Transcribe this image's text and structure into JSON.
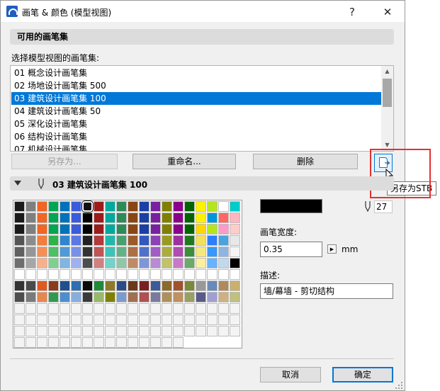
{
  "window": {
    "title": "画笔 & 颜色 (模型视图)",
    "help_label": "?",
    "close_label": "✕"
  },
  "available_sets": {
    "header": "可用的画笔集",
    "list_label": "选择模型视图的画笔集:",
    "items": [
      "01 概念设计画笔集",
      "02 场地设计画笔集 500",
      "03 建筑设计画笔集 100",
      "04 建筑设计画笔集 50",
      "05 深化设计画笔集",
      "06 结构设计画笔集",
      "07 机械设计画笔集"
    ],
    "selected_index": 2
  },
  "buttons": {
    "save_as": "另存为...",
    "rename": "重命名...",
    "delete": "删除",
    "save_stb_tooltip": "另存为STB",
    "cancel": "取消",
    "ok": "确定"
  },
  "pen_set": {
    "header": "03 建筑设计画笔集 100",
    "pen_number": "27",
    "selected_color": "#000000",
    "width_label": "画笔宽度:",
    "width_value": "0.35",
    "width_unit": "mm",
    "description_label": "描述:",
    "description_value": "墙/幕墙 - 剪切结构"
  },
  "palette": {
    "columns": 20,
    "rows": [
      [
        "#1a1a1a",
        "#7f7f7f",
        "#f26522",
        "#00a651",
        "#0072bc",
        "#3b5bdb",
        "#111111",
        "#9e1b1b",
        "#00a99d",
        "#2e8b57",
        "#8b4513",
        "#1c3fa6",
        "#7b1fa2",
        "#808000",
        "#8b008b",
        "#006400",
        "#fff200",
        "#b5e61d",
        "#ffffff",
        "#00cccc"
      ],
      [
        "#1a1a1a",
        "#7f7f7f",
        "#f26522",
        "#00a651",
        "#0072bc",
        "#3b5bdb",
        "#000000",
        "#9e1b1b",
        "#00a99d",
        "#2e8b57",
        "#8b4513",
        "#1c3fa6",
        "#7b1fa2",
        "#808000",
        "#8b008b",
        "#006400",
        "#fff200",
        "#0095d9",
        "#ff6666",
        "#ffb6c1"
      ],
      [
        "#1a1a1a",
        "#7f7f7f",
        "#f26522",
        "#00a651",
        "#0072bc",
        "#3b5bdb",
        "#000000",
        "#9e1b1b",
        "#00a99d",
        "#2e8b57",
        "#8b4513",
        "#1c3fa6",
        "#7b1fa2",
        "#808000",
        "#8b008b",
        "#006400",
        "#ffd700",
        "#b5e61d",
        "#ff99cc",
        "#ffcccc"
      ],
      [
        "#555555",
        "#8c8c8c",
        "#f47c3c",
        "#2db34a",
        "#2f86d0",
        "#5b78e6",
        "#222222",
        "#b23a3a",
        "#1fb8ad",
        "#48a06f",
        "#9c5a2a",
        "#3357bf",
        "#8f3fb8",
        "#9a9a1f",
        "#a030a0",
        "#1f7a1f",
        "#f5e05a",
        "#2a7fff",
        "#4aa3df",
        "#e8e8e8"
      ],
      [
        "#606060",
        "#969696",
        "#f68f55",
        "#4cc064",
        "#4f9ad8",
        "#7790ea",
        "#333333",
        "#c05555",
        "#3cc4b8",
        "#62b287",
        "#ac6f42",
        "#4f70cc",
        "#a25cc6",
        "#acac3c",
        "#b24cb2",
        "#3a8f3a",
        "#f7e87a",
        "#3399ff",
        "#8db4e2",
        "#f5f5f5"
      ],
      [
        "#6e6e6e",
        "#a6a6a6",
        "#f9b08a",
        "#7fd08e",
        "#7fb6e3",
        "#9fb1f0",
        "#4d4d4d",
        "#d08080",
        "#70d4cb",
        "#8fc8a6",
        "#c08a66",
        "#7f96d9",
        "#b98ad5",
        "#c2c26b",
        "#c77ac7",
        "#6aab6a",
        "#faf0a0",
        "#66b3ff",
        "#c0d8f0",
        "#000000"
      ],
      [
        "#ffffff",
        "#ffffff",
        "#ffffff",
        "#ffffff",
        "#ffffff",
        "#ffffff",
        "#ffffff",
        "#ffffff",
        "#ffffff",
        "#ffffff",
        "#ffffff",
        "#ffffff",
        "#ffffff",
        "#ffffff",
        "#ffffff",
        "#ffffff",
        "#ffffff",
        "#ffffff",
        "#ffffff",
        "#ffffff"
      ],
      [
        "#333333",
        "#4a4a4a",
        "#e05a20",
        "#8a3b1c",
        "#1f4f8f",
        "#2d6fb0",
        "#0a0a0a",
        "#1e8a3a",
        "#8c7a2a",
        "#2a4d8a",
        "#6b3a1c",
        "#7a2020",
        "#3c5a9a",
        "#8c6a2a",
        "#a0522d",
        "#7a8a3a",
        "#999999",
        "#6a8ab8",
        "#b08a5a",
        "#c8b070"
      ],
      [
        "#4d4d4d",
        "#7a7a7a",
        "#e8864f",
        "#2f9a4f",
        "#4a8fcf",
        "#88aee0",
        "#3a3a3a",
        "#9ab86a",
        "#808000",
        "#7a9ad0",
        "#a07050",
        "#b05050",
        "#7a7aa0",
        "#b0905a",
        "#c09060",
        "#9aa060",
        "#5a5a8a",
        "#a0a0d0",
        "#d0b080",
        "#c0c080"
      ]
    ],
    "empty_rows": 4,
    "marked_cell": [
      0,
      6
    ]
  }
}
